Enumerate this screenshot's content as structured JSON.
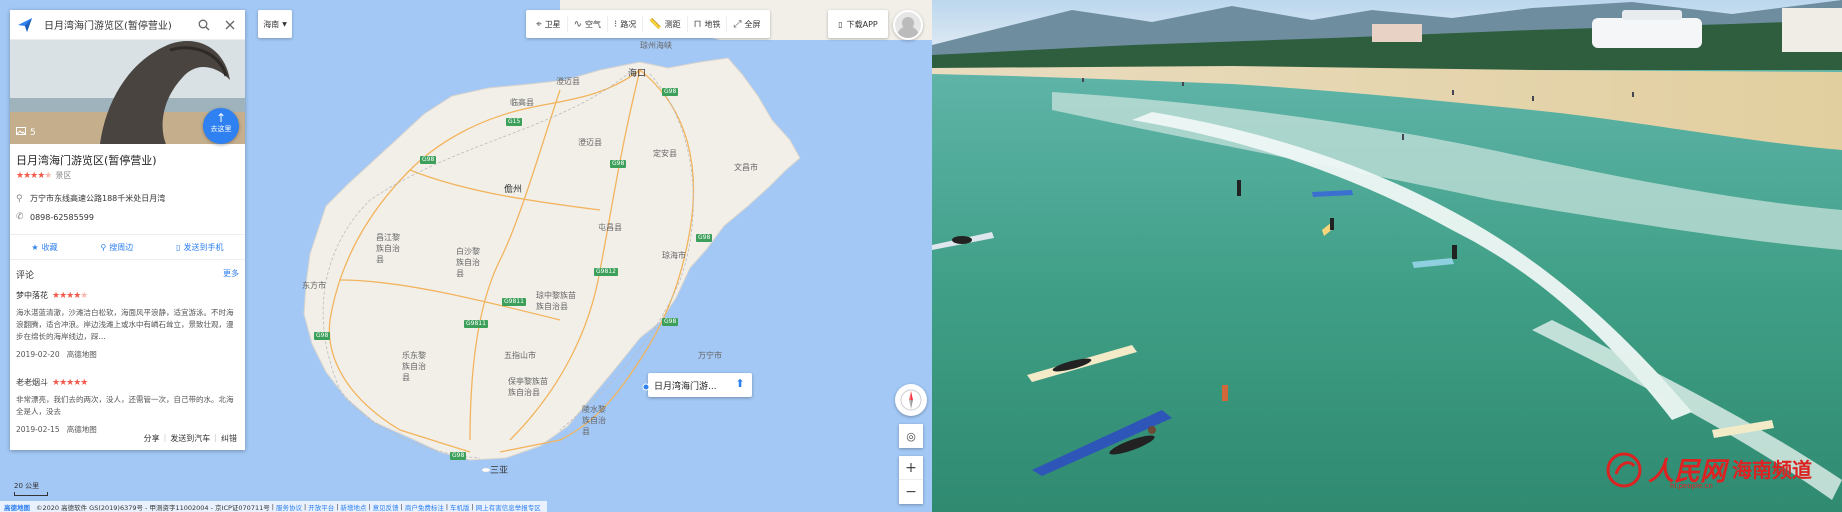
{
  "search": {
    "value": "日月湾海门游览区(暂停营业)"
  },
  "poi": {
    "photo_count": "5",
    "title": "日月湾海门游览区(暂停营业)",
    "category": "景区",
    "address": "万宁市东线高速公路188千米处日月湾",
    "phone": "0898-62585599",
    "route_button": "去这里"
  },
  "actions": {
    "favorite": "收藏",
    "nearby": "搜周边",
    "send_phone": "发送到手机"
  },
  "reviews": {
    "title": "评论",
    "more": "更多",
    "items": [
      {
        "author": "梦中落花",
        "text": "海水湛蓝清澈，沙滩洁白松软，海面风平浪静，适宜游泳。不时海浪翻腾，适合冲浪。岸边浅滩上或水中有嶙石耸立，景致壮观，漫步在绵长的海岸线边，踩...",
        "date": "2019-02-20",
        "source": "高德地图"
      },
      {
        "author": "老老烟斗",
        "text": "非常漂亮，我们去的两次，没人，还需管一次，自己带的水。北海全是人，没去",
        "date": "2019-02-15",
        "source": "高德地图"
      }
    ]
  },
  "panel_footer": {
    "share": "分享",
    "send_car": "发送到汽车",
    "error": "纠错"
  },
  "map": {
    "region": "海南",
    "toolbar": [
      "卫星",
      "空气",
      "路况",
      "测距",
      "地铁",
      "全屏"
    ],
    "download": "下载APP",
    "marker_label": "日月湾海门游...",
    "scale": "20 公里",
    "copyright_brand": "高德地图",
    "copyright": "©2020 高德软件 GS(2019)6379号 - 甲测资字11002004 - 京ICP证070711号",
    "links": [
      "服务协议",
      "开放平台",
      "新增地点",
      "意见反馈",
      "商户免费标注",
      "车机版",
      "网上有害信息举报专区"
    ],
    "places": [
      {
        "name": "海口",
        "city": true
      },
      {
        "name": "琼州海峡",
        "city": false
      },
      {
        "name": "儋州",
        "city": true
      },
      {
        "name": "三亚",
        "city": true
      },
      {
        "name": "文昌市",
        "city": false
      },
      {
        "name": "定安县",
        "city": false
      },
      {
        "name": "澄迈县",
        "city": false
      },
      {
        "name": "临高县",
        "city": false
      },
      {
        "name": "屯昌县",
        "city": false
      },
      {
        "name": "琼海市",
        "city": false
      },
      {
        "name": "白沙黎族自治县",
        "city": false
      },
      {
        "name": "琼中黎族苗族自治县",
        "city": false
      },
      {
        "name": "万宁市",
        "city": false
      },
      {
        "name": "五指山市",
        "city": false
      },
      {
        "name": "乐东黎族自治县",
        "city": false
      },
      {
        "name": "保亭黎族苗族自治县",
        "city": false
      },
      {
        "name": "陵水黎族自治县",
        "city": false
      },
      {
        "name": "昌江黎族自治县",
        "city": false
      },
      {
        "name": "东方市",
        "city": false
      },
      {
        "name": "澄迈县",
        "city": false
      }
    ]
  },
  "photo": {
    "watermark_brand": "人民网",
    "watermark_region": "海南频道",
    "watermark_url": "hi.people.cn"
  },
  "colors": {
    "sea": "#a3c8f5",
    "land": "#f2efe9",
    "accent": "#2f80f0",
    "stars": "#f25b4c"
  }
}
